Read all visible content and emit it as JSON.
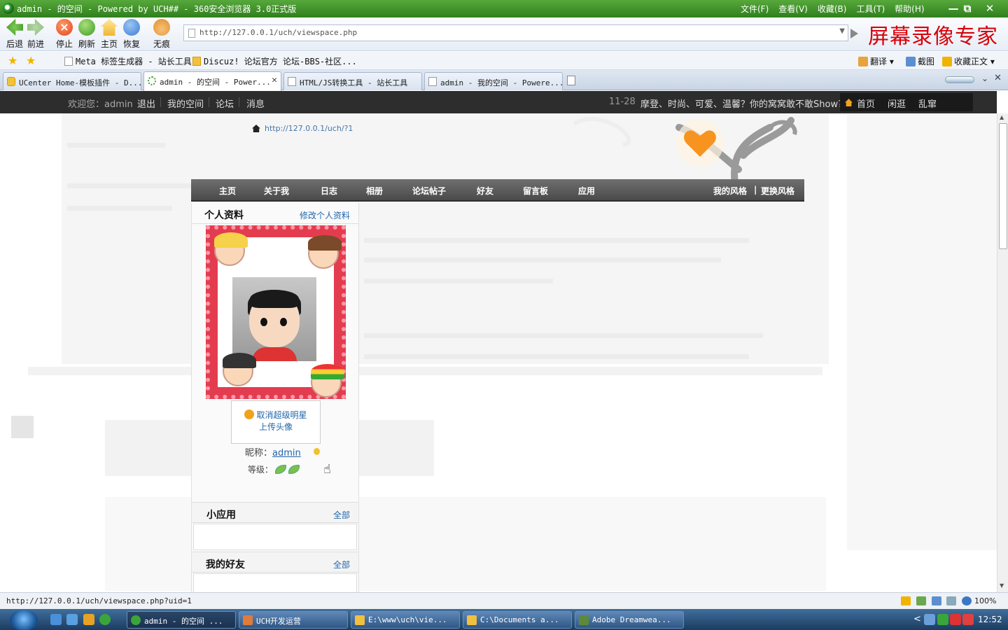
{
  "browser": {
    "window_title": "admin - 的空间 - Powered by UCH## - 360安全浏览器 3.0正式版",
    "menus": [
      "文件(F)",
      "查看(V)",
      "收藏(B)",
      "工具(T)",
      "帮助(H)"
    ],
    "window_controls": [
      "—",
      "⧉",
      "✕"
    ],
    "toolbar": {
      "back": "后退",
      "forward": "前进",
      "stop": "停止",
      "refresh": "刷新",
      "home": "主页",
      "restore": "恢复",
      "incognito": "无痕"
    },
    "address": "http://127.0.0.1/uch/viewspace.php",
    "watermark": "屏幕录像专家",
    "favorites": [
      {
        "label": "Meta 标签生成器 - 站长工具"
      },
      {
        "label": "Discuz! 论坛官方 论坛-BBS-社区..."
      }
    ],
    "fav_tools": {
      "translate": "翻译",
      "screenshot": "截图",
      "collect": "收藏正文"
    },
    "tabs": [
      {
        "label": "UCenter Home-模板插件 - D..."
      },
      {
        "label": "admin - 的空间 - Power..."
      },
      {
        "label": "HTML/JS转换工具 - 站长工具"
      },
      {
        "label": "admin - 我的空间 - Powere..."
      }
    ],
    "tab_close": "✕",
    "status_url": "http://127.0.0.1/uch/viewspace.php?uid=1",
    "zoom": "100%"
  },
  "site_topbar": {
    "welcome": "欢迎您：admin",
    "logout": "退出",
    "my_space": "我的空间",
    "forum": "论坛",
    "messages": "消息",
    "news_date": "11-28",
    "news_text": "摩登、时尚、可爱、温馨？你的窝窝敢不敢Show?",
    "home": "首页",
    "wander": "闲逛",
    "random": "乱窜"
  },
  "page": {
    "breadcrumb_url": "http://127.0.0.1/uch/?1",
    "nav": [
      "主页",
      "关于我",
      "日志",
      "相册",
      "论坛帖子",
      "好友",
      "留言板",
      "应用"
    ],
    "nav_right": {
      "my_style": "我的风格",
      "divider": "|",
      "change_style": "更换风格"
    },
    "profile": {
      "title": "个人资料",
      "edit_link": "修改个人资料",
      "cancel_star": "取消超级明星",
      "upload_avatar": "上传头像",
      "nickname_label": "昵称：",
      "nickname": "admin",
      "level_label": "等级："
    },
    "apps_box": {
      "title": "小应用",
      "more": "全部"
    },
    "friends_box": {
      "title": "我的好友",
      "more": "全部"
    }
  },
  "taskbar": {
    "tasks": [
      {
        "label": "admin - 的空间 ..."
      },
      {
        "label": "UCH开发运营"
      },
      {
        "label": "E:\\www\\uch\\vie..."
      },
      {
        "label": "C:\\Documents a..."
      },
      {
        "label": "Adobe Dreamwea..."
      }
    ],
    "clock": "12:52",
    "tray_arrow": "<"
  },
  "colors": {
    "titlebar": "#2f7f1d",
    "site_bar": "#2d2d2d",
    "nav_bar": "#4a4a4a",
    "link": "#2266aa",
    "heart": "#f7931e",
    "avatar_frame": "#e43c4f"
  }
}
